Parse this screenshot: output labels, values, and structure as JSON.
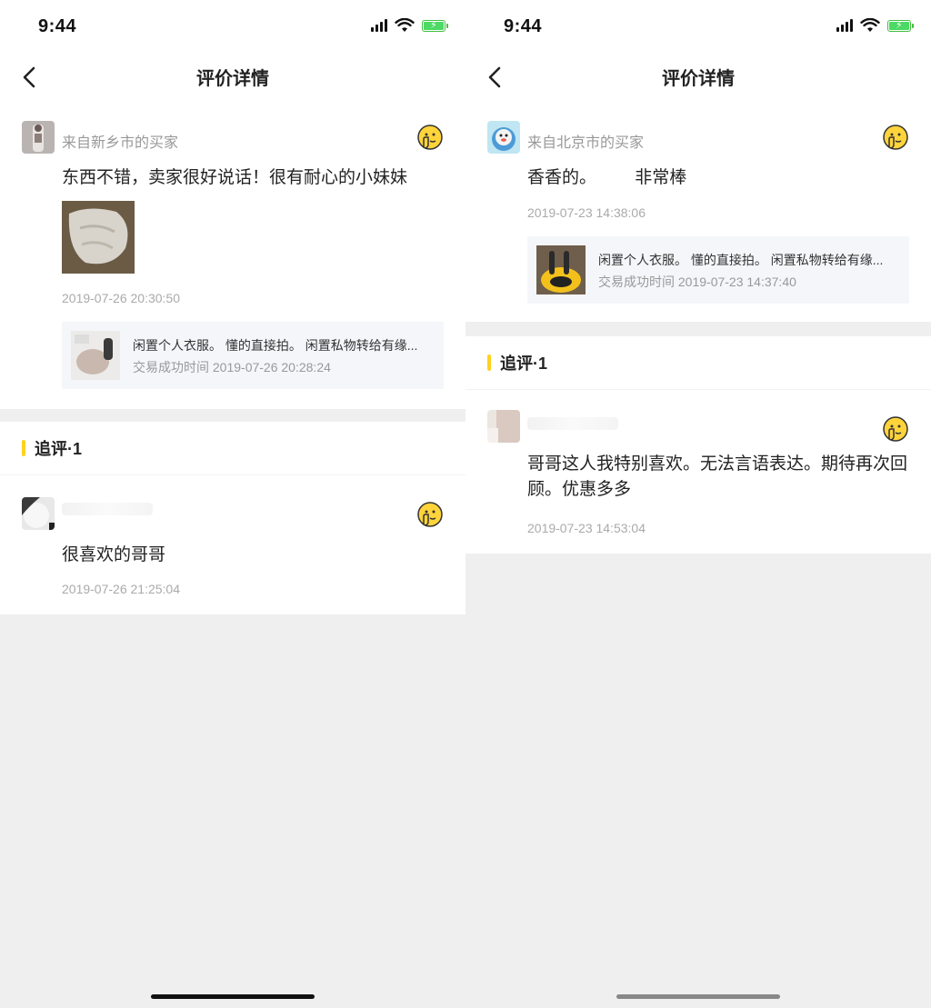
{
  "left": {
    "status": {
      "time": "9:44"
    },
    "nav": {
      "title": "评价详情"
    },
    "review": {
      "from": "来自新乡市的买家",
      "text": "东西不错，卖家很好说话！很有耐心的小妹妹",
      "date": "2019-07-26 20:30:50",
      "product": {
        "title": "闲置个人衣服。 懂的直接拍。 闲置私物转给有缘...",
        "trade_time": "交易成功时间 2019-07-26 20:28:24"
      }
    },
    "followup": {
      "section_title": "追评·1",
      "text": "很喜欢的哥哥",
      "date": "2019-07-26 21:25:04"
    }
  },
  "right": {
    "status": {
      "time": "9:44"
    },
    "nav": {
      "title": "评价详情"
    },
    "review": {
      "from": "来自北京市的买家",
      "text": "香香的。        非常棒",
      "date": "2019-07-23 14:38:06",
      "product": {
        "title": "闲置个人衣服。 懂的直接拍。 闲置私物转给有缘...",
        "trade_time": "交易成功时间 2019-07-23 14:37:40"
      }
    },
    "followup": {
      "section_title": "追评·1",
      "text": "哥哥这人我特别喜欢。无法言语表达。期待再次回顾。优惠多多",
      "date": "2019-07-23 14:53:04"
    }
  },
  "icons": {
    "back": "chevron-left-icon",
    "emoji": "shushing-face-emoji-icon",
    "signal": "cellular-signal-icon",
    "wifi": "wifi-icon",
    "battery": "battery-charging-icon"
  },
  "colors": {
    "accent": "#ffd21f",
    "background": "#efefef",
    "card": "#ffffff",
    "muted_text": "#999999",
    "battery": "#4cd964"
  }
}
